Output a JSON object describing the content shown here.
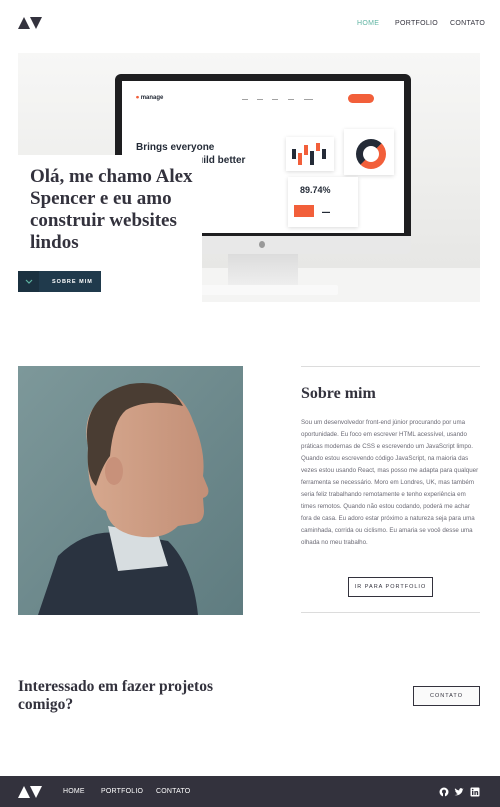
{
  "header": {
    "logo_icon": "logo-icon",
    "nav": {
      "home": "HOME",
      "portfolio": "PORTFOLIO",
      "contact": "CONTATO"
    },
    "active_color": "#5fb4a2"
  },
  "hero": {
    "title": "Olá, me chamo Alex Spencer e eu amo construir websites lindos",
    "button_label": "SOBRE MIM",
    "button_icon": "chevron-down-icon",
    "screen": {
      "brand": "manage",
      "headline": "Brings everyone together to build better products.",
      "stat": "89.74%"
    }
  },
  "about": {
    "title": "Sobre mim",
    "body": "Sou um desenvolvedor front-end júnior procurando por uma oportunidade. Eu foco em escrever HTML acessível, usando práticas modernas de CSS e escrevendo um JavaScript limpo. Quando estou escrevendo código JavaScript, na maioria das vezes estou usando React, mas posso me adapta para qualquer ferramenta se necessário. Moro em Londres, UK, mas também seria feliz trabalhando remotamente e tenho experiência em times remotos. Quando não estou codando, poderá me achar fora de casa. Eu adoro estar próximo a natureza seja para uma caminhada, corrida ou ciclismo. Eu amaria se você desse uma olhada no meu trabalho.",
    "button_label": "IR PARA PORTFOLIO"
  },
  "cta": {
    "title": "Interessado em fazer projetos comigo?",
    "button_label": "CONTATO"
  },
  "footer": {
    "nav": {
      "home": "HOME",
      "portfolio": "PORTFOLIO",
      "contact": "CONTATO"
    },
    "social_icons": [
      "github-icon",
      "twitter-icon",
      "linkedin-icon"
    ]
  },
  "colors": {
    "dark": "#33323d",
    "accent_cyan": "#5fb4a2",
    "hero_button": "#203a4c",
    "screen_orange": "#f25f3a"
  }
}
